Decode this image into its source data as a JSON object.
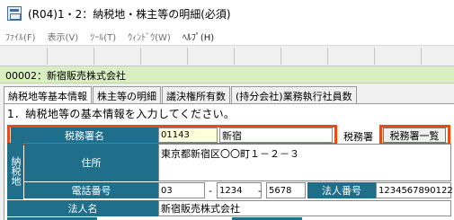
{
  "window": {
    "title": "(R04)1・2：納税地・株主等の明細(必須)"
  },
  "menu": {
    "items": [
      {
        "label": "ﾌｧｲﾙ(F)",
        "disabled": true
      },
      {
        "label": "表示(V)",
        "disabled": true
      },
      {
        "label": "ﾂｰﾙ(T)",
        "disabled": true
      },
      {
        "label": "ｳｨﾝﾄﾞｳ(W)",
        "disabled": true
      },
      {
        "label": "ﾍﾙﾌﾟ(H)",
        "disabled": false
      }
    ]
  },
  "company": {
    "label": "00002：新宿販売株式会社"
  },
  "tabs": [
    {
      "label": "納税地等基本情報",
      "active": true
    },
    {
      "label": "株主等の明細",
      "active": false
    },
    {
      "label": "議決権所有数",
      "active": false
    },
    {
      "label": "(持分会社)業務執行社員数",
      "active": false
    }
  ],
  "form": {
    "instruction": "1．納税地等の基本情報を入力してください。",
    "tax_office": {
      "label": "税務署名",
      "code": "01143",
      "name": "新宿",
      "suffix": "税務署",
      "list_button": "税務署一覧"
    },
    "taxpayer_place_label": "納税地",
    "address": {
      "label": "住所",
      "value": "東京都新宿区〇〇町１－２－３"
    },
    "phone": {
      "label": "電話番号",
      "part1": "03",
      "part2": "1234",
      "part3": "5678",
      "sep1": "-",
      "sep2": "-"
    },
    "corp_number": {
      "label": "法人番号",
      "value": "1234567890122"
    },
    "corp_name": {
      "label": "法人名",
      "value": "新宿販売株式会社"
    }
  }
}
